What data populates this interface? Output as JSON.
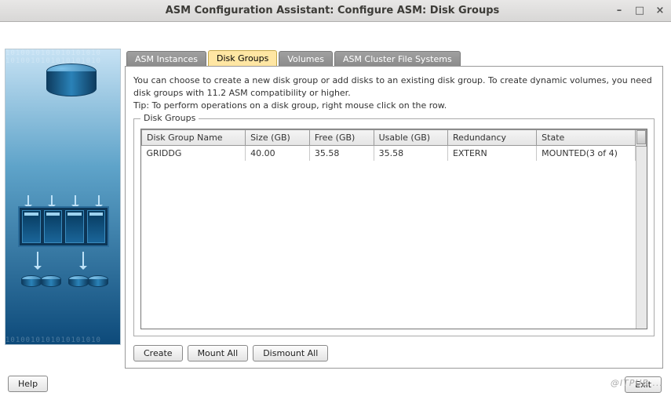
{
  "window": {
    "title": "ASM Configuration Assistant: Configure ASM: Disk Groups"
  },
  "tabs": {
    "items": [
      {
        "label": "ASM Instances"
      },
      {
        "label": "Disk Groups"
      },
      {
        "label": "Volumes"
      },
      {
        "label": "ASM Cluster File Systems"
      }
    ],
    "active_index": 1
  },
  "description": {
    "line1": "You can choose to create a new disk group or add disks to an existing disk group. To create dynamic volumes, you need disk groups with 11.2 ASM compatibility or higher.",
    "line2": "Tip: To perform operations on a disk group, right mouse click on the row."
  },
  "fieldset": {
    "legend": "Disk Groups"
  },
  "table": {
    "columns": [
      "Disk Group Name",
      "Size (GB)",
      "Free (GB)",
      "Usable (GB)",
      "Redundancy",
      "State"
    ],
    "rows": [
      {
        "name": "GRIDDG",
        "size": "40.00",
        "free": "35.58",
        "usable": "35.58",
        "redundancy": "EXTERN",
        "state": "MOUNTED(3 of 4)"
      }
    ]
  },
  "buttons": {
    "create": "Create",
    "mount_all": "Mount All",
    "dismount_all": "Dismount All",
    "help": "Help",
    "exit": "Exit"
  },
  "watermark": "@ITPUB ..."
}
